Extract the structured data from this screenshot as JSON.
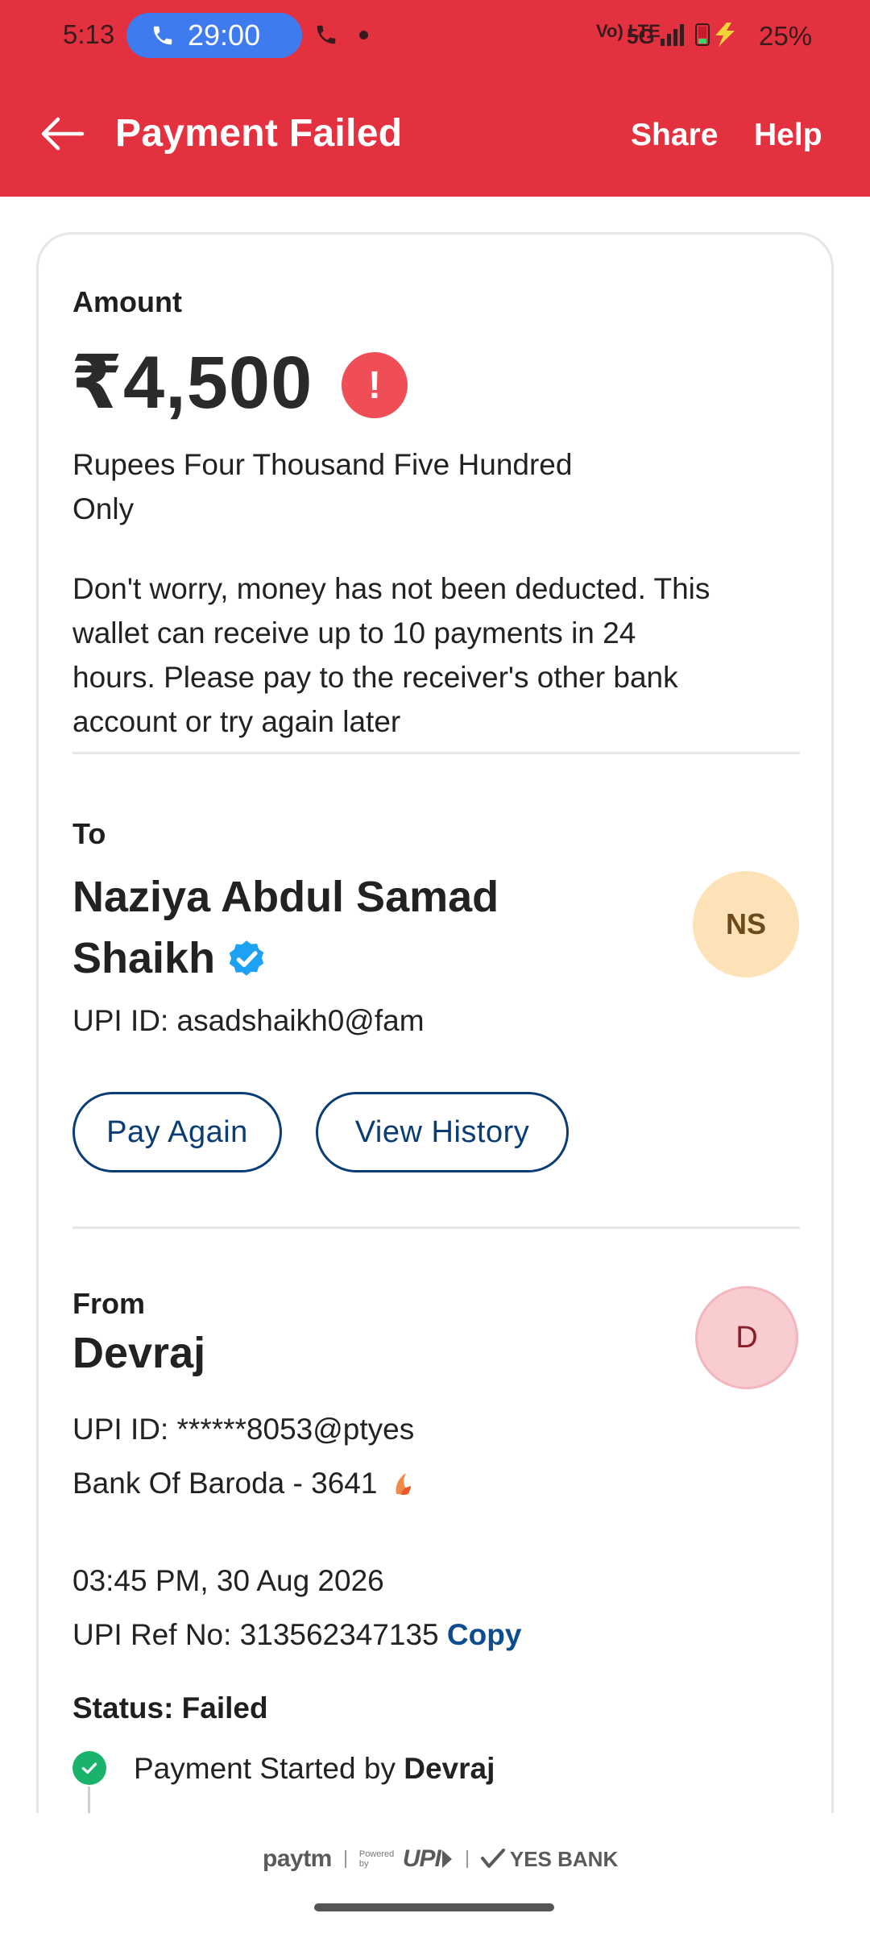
{
  "status_bar": {
    "time": "5:13",
    "call_timer": "29:00",
    "network_label": "Vo) LTE",
    "network_type": "5G",
    "battery_percent": "25%"
  },
  "app_bar": {
    "title": "Payment Failed",
    "share_label": "Share",
    "help_label": "Help"
  },
  "amount_section": {
    "label": "Amount",
    "amount": "₹4,500",
    "alert_symbol": "!",
    "amount_words_line1": "Rupees Four Thousand Five Hundred",
    "amount_words_line2": "Only",
    "message_lines": [
      "Don't worry, money has not been deducted. This",
      "wallet can receive up to 10 payments in 24",
      "hours. Please pay to the receiver's other bank",
      "account or try again later"
    ]
  },
  "to_section": {
    "label": "To",
    "name_line1": "Naziya Abdul Samad",
    "name_line2": "Shaikh",
    "upi_id": "UPI ID: asadshaikh0@fam",
    "avatar_initials": "NS",
    "pay_again_label": "Pay Again",
    "view_history_label": "View History"
  },
  "from_section": {
    "label": "From",
    "name": "Devraj",
    "avatar_initial": "D",
    "upi_id": "UPI ID: ******8053@ptyes",
    "bank": "Bank Of Baroda - 3641"
  },
  "transaction": {
    "datetime": "03:45 PM, 30 Aug 2026",
    "ref_label": "UPI Ref No: 313562347135",
    "copy_label": "Copy",
    "status": "Status: Failed",
    "timeline_text": "Payment Started by",
    "timeline_name": "Devraj"
  },
  "footer": {
    "paytm": "paytm",
    "powered_by": "Powered by",
    "upi": "UPI",
    "bank_partner": "YES BANK"
  },
  "colors": {
    "header_red": "#e3313f",
    "call_pill_blue": "#3e7bf0",
    "button_navy": "#0a3d75",
    "alert_red": "#ef4e56",
    "success_green": "#19b36b",
    "verified_blue": "#1da1f2",
    "avatar_ns_bg": "#fde2b8",
    "avatar_d_bg": "#f9ccd0"
  }
}
